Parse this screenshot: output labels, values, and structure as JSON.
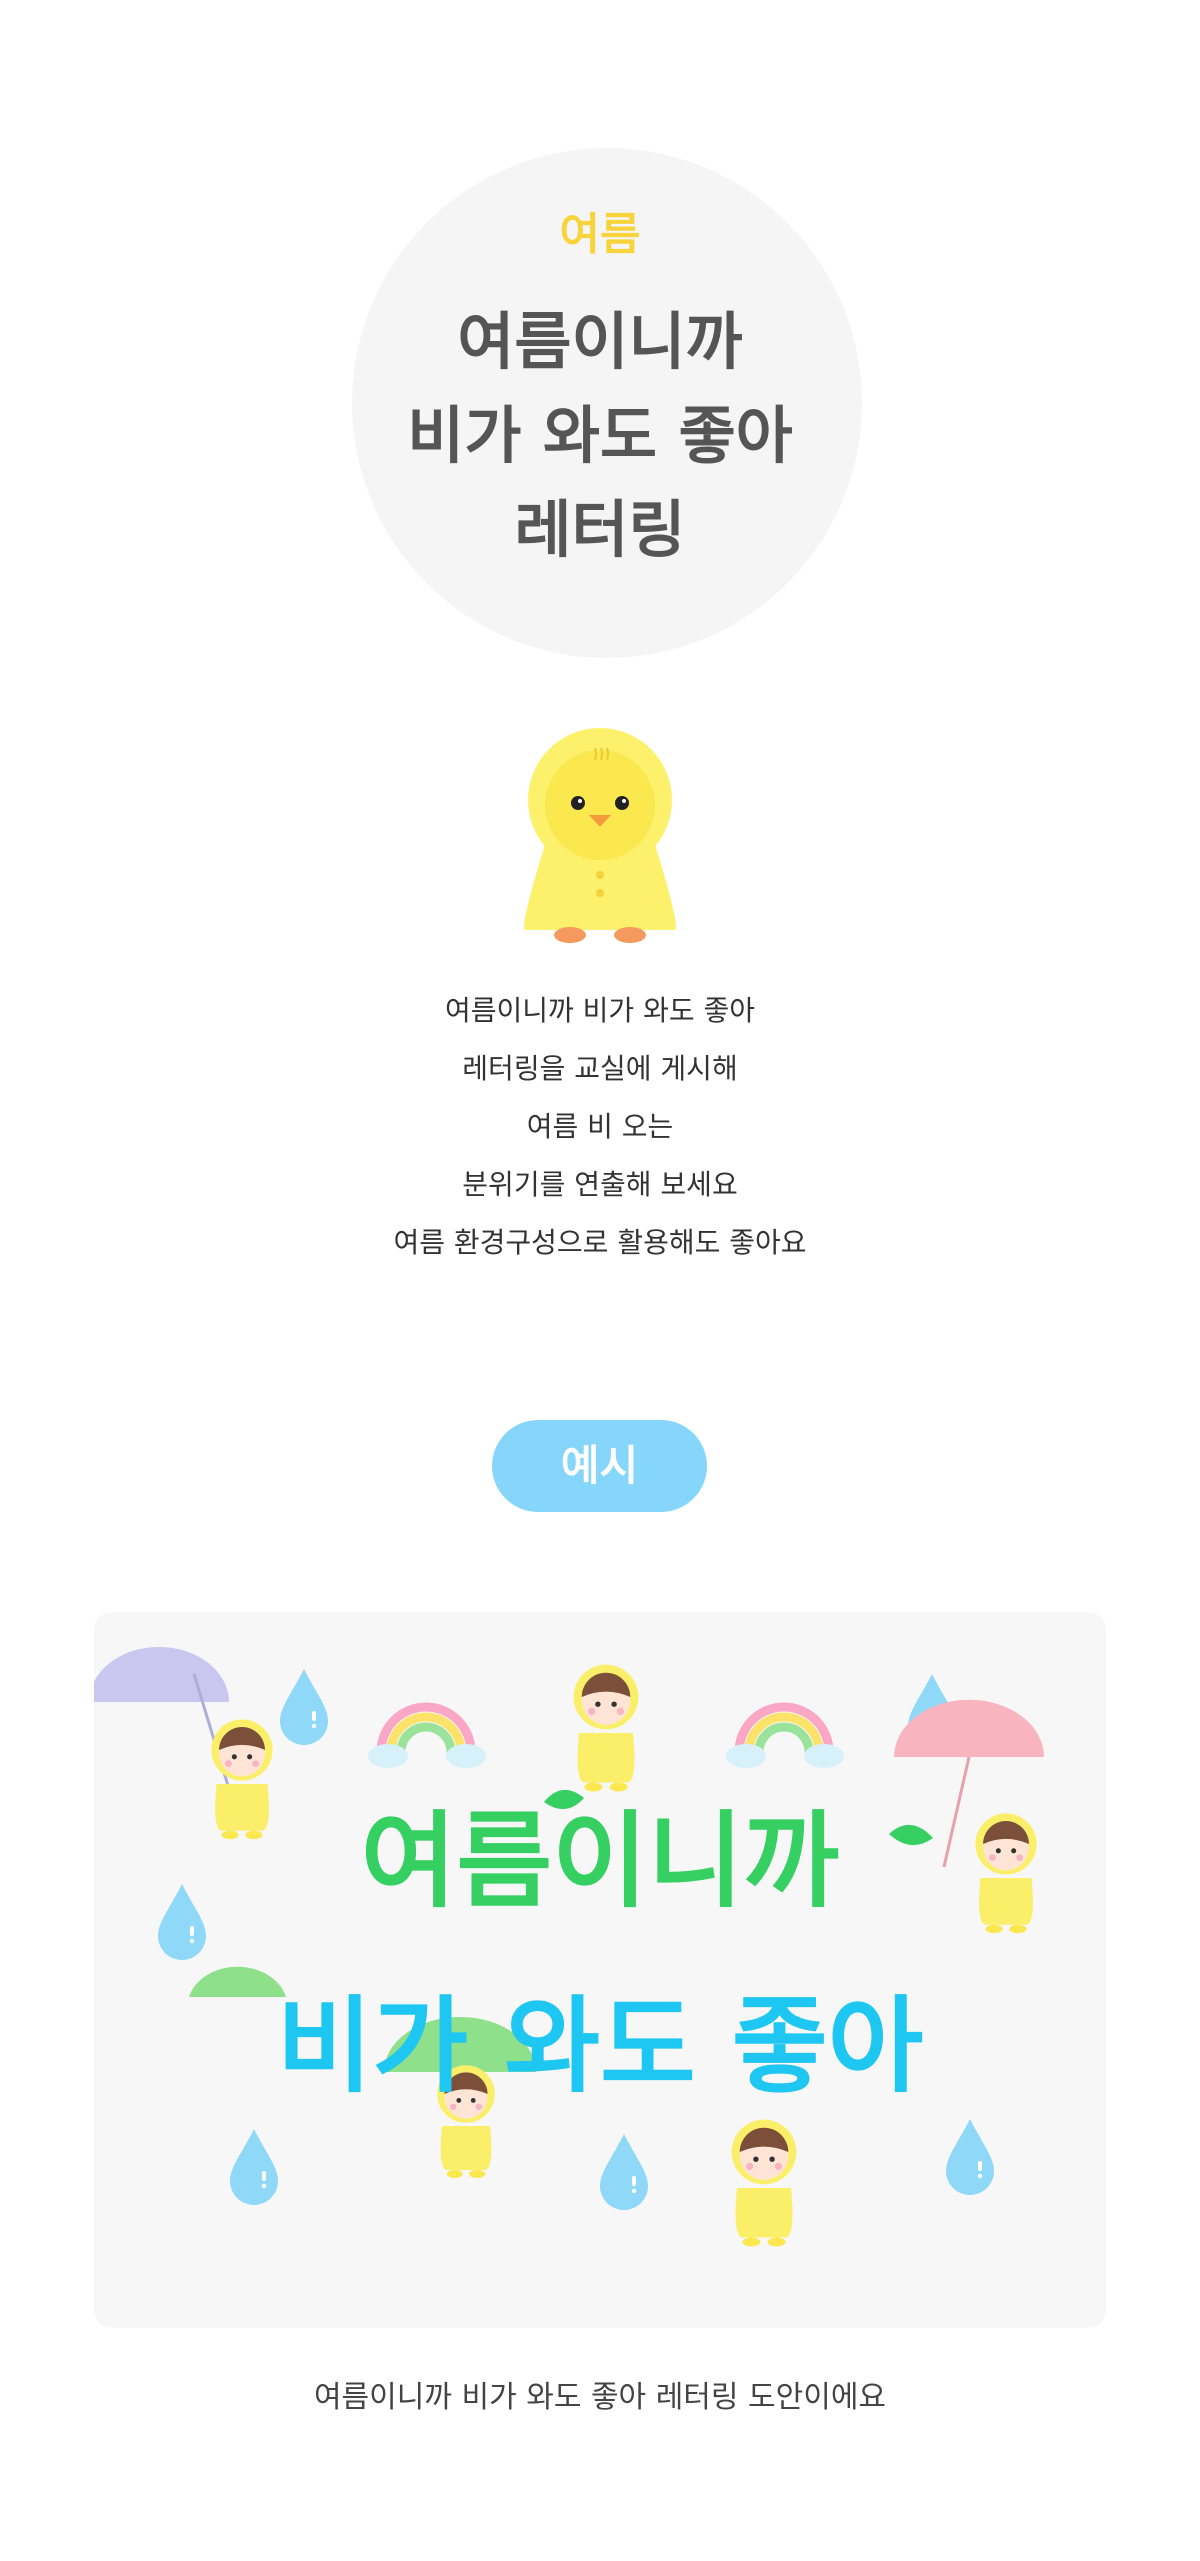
{
  "hero": {
    "tag": "여름",
    "title_lines": [
      "여름이니까",
      "비가 와도 좋아",
      "레터링"
    ]
  },
  "description": {
    "lines": [
      "여름이니까 비가 와도 좋아",
      "레터링을 교실에 게시해",
      "여름 비 오는",
      "분위기를 연출해 보세요",
      "여름 환경구성으로 활용해도 좋아요"
    ]
  },
  "example": {
    "label": "예시",
    "lettering_line1": "여름이니까",
    "lettering_line2": "비가 와도 좋아",
    "colors": {
      "line1": "#35cf62",
      "line2": "#1ec6f2",
      "drop": "#8fd8f8",
      "raincoat": "#fbef6a"
    }
  },
  "caption": "여름이니까 비가 와도 좋아 레터링 도안이에요",
  "colors": {
    "accent_yellow": "#f8d43c",
    "pill_blue": "#86d5fa",
    "title_gray": "#555555"
  }
}
